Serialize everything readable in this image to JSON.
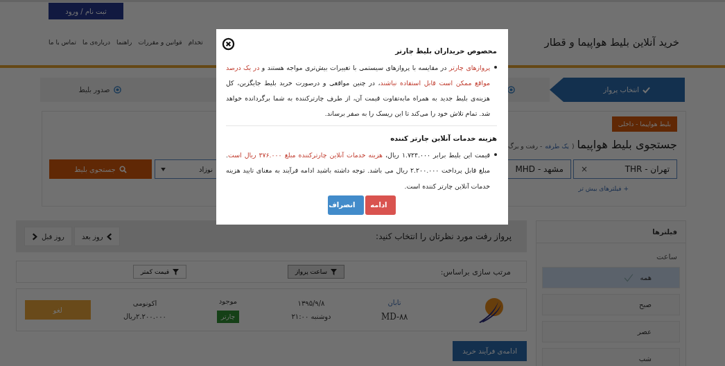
{
  "header": {
    "login_button": "ثبت نام / ورود",
    "title": "خرید آنلاین بلیط هواپیما و قطار",
    "nav": [
      "تخدام",
      "قوانین و مقررات",
      "راهنما",
      "درباره‌ی ما",
      "تماس با ما"
    ]
  },
  "steps": [
    {
      "label": "انتخاب پرواز",
      "selected": true
    },
    {
      "selected": false
    },
    {
      "label": "صدور بلیط",
      "selected": false
    }
  ],
  "search": {
    "badge": "بلیط هواپیما - داخلی",
    "title": "جستجوی بلیط هواپیما",
    "trip_open": "(",
    "trip_link": "یک طرفه",
    "trip_rest": "- رفت و برگ",
    "origin": "تهران - THR",
    "clear": "×",
    "destination": "مشهد - MHD",
    "passengers": "نوزاد",
    "search_button": "جستجوی بلیط",
    "more_filters": "+ فیلترهای بیش تر"
  },
  "date_bar": {
    "prompt": "پرواز رفت مورد نظرتان را انتخاب کنید:",
    "prev": "روز قبل",
    "next": "روز بعد"
  },
  "sort": {
    "label": "مرتب سازی براساس:",
    "options": [
      {
        "label": "ساعت پرواز",
        "selected": true
      },
      {
        "label": "قیمت کمتر",
        "selected": false
      }
    ]
  },
  "flights": [
    {
      "airline": "تابان",
      "flight_no": "MD-۸۸",
      "date": "۱۳۹۵/۹/۸",
      "day_time": "دوشنبه ۲۱:۰۰",
      "availability": "موجود",
      "type": "چارتر",
      "class": "اکونومی",
      "price": "۲.۲۰۰.۰۰۰ریال",
      "action": "لغو"
    }
  ],
  "continue_button": "ادامه‌ی فرآیند خرید",
  "filters": {
    "title": "فیلترها",
    "group": "ساعت",
    "options": [
      {
        "label": "همه",
        "selected": true
      },
      {
        "label": "صبح",
        "selected": false
      },
      {
        "label": "عصر",
        "selected": false
      },
      {
        "label": "شب",
        "selected": false
      }
    ]
  },
  "modal": {
    "sections": [
      {
        "heading": "مخصوص خریداران بلیط چارتر",
        "paragraph": [
          {
            "text": "پروازهای چارتر",
            "highlight": true
          },
          {
            "text": " در مقایسه با پروازهای سیستمی با تغییرات بیش‌تری مواجه هستند و ",
            "highlight": false
          },
          {
            "text": "در یک درصد مواقع ممکن است قابل استفاده نباشند",
            "highlight": true
          },
          {
            "text": "، در چنین مواقعی و درصورت خرید بلیط جایگزین، کل هزینه‌ی بلیط جدید به همراه مابه‌تفاوت قیمت آن، از طرف چارترکننده به شما برگردانده خواهد شد. تمام تلاش خود را می‌کند تا این ریسک را به صفر برساند.",
            "highlight": false
          }
        ]
      },
      {
        "heading": "هزینه خدمات آنلاین چارتر کننده",
        "paragraph": [
          {
            "text": "قیمت این بلیط برابر ۱.۷۲۴.۰۰۰ ریال، ",
            "highlight": false
          },
          {
            "text": "هزینه خدمات آنلاین چارترکننده مبلغ ۴۷۶.۰۰۰ ریال است",
            "highlight": true
          },
          {
            "text": ". مبلغ قابل پرداخت ۲.۲۰۰.۰۰۰ ریال می باشد. توجه داشته باشید ادامه فرآیند به معنای تایید هزینه خدمات آنلاین چارتر کننده است.",
            "highlight": false
          }
        ]
      }
    ],
    "buttons": [
      {
        "label": "ادامه",
        "kind": "confirm"
      },
      {
        "label": "انصراف",
        "kind": "cancel"
      }
    ]
  }
}
